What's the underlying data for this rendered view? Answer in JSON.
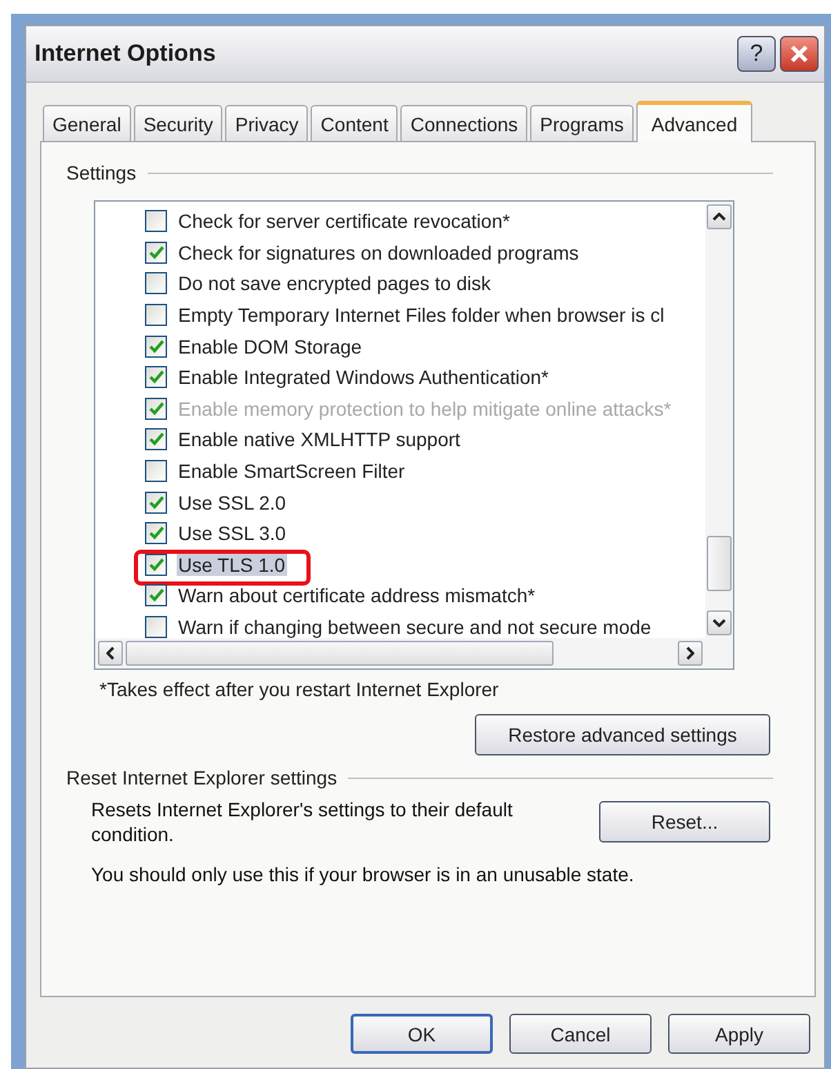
{
  "window": {
    "title": "Internet Options",
    "title_buttons": [
      "?"
    ]
  },
  "tabs": [
    {
      "label": "General",
      "selected": false
    },
    {
      "label": "Security",
      "selected": false
    },
    {
      "label": "Privacy",
      "selected": false
    },
    {
      "label": "Content",
      "selected": false
    },
    {
      "label": "Connections",
      "selected": false
    },
    {
      "label": "Programs",
      "selected": false
    },
    {
      "label": "Advanced",
      "selected": true
    }
  ],
  "settings": {
    "heading": "Settings",
    "items": [
      {
        "label": "Check for server certificate revocation*",
        "checked": false,
        "disabled": false,
        "selected": false,
        "outlined": false
      },
      {
        "label": "Check for signatures on downloaded programs",
        "checked": true,
        "disabled": false,
        "selected": false,
        "outlined": false
      },
      {
        "label": "Do not save encrypted pages to disk",
        "checked": false,
        "disabled": false,
        "selected": false,
        "outlined": false
      },
      {
        "label": "Empty Temporary Internet Files folder when browser is cl",
        "checked": false,
        "disabled": false,
        "selected": false,
        "outlined": false
      },
      {
        "label": "Enable DOM Storage",
        "checked": true,
        "disabled": false,
        "selected": false,
        "outlined": false
      },
      {
        "label": "Enable Integrated Windows Authentication*",
        "checked": true,
        "disabled": false,
        "selected": false,
        "outlined": false
      },
      {
        "label": "Enable memory protection to help mitigate online attacks*",
        "checked": true,
        "disabled": true,
        "selected": false,
        "outlined": false
      },
      {
        "label": "Enable native XMLHTTP support",
        "checked": true,
        "disabled": false,
        "selected": false,
        "outlined": false
      },
      {
        "label": "Enable SmartScreen Filter",
        "checked": false,
        "disabled": false,
        "selected": false,
        "outlined": false
      },
      {
        "label": "Use SSL 2.0",
        "checked": true,
        "disabled": false,
        "selected": false,
        "outlined": false
      },
      {
        "label": "Use SSL 3.0",
        "checked": true,
        "disabled": false,
        "selected": false,
        "outlined": false
      },
      {
        "label": "Use TLS 1.0",
        "checked": true,
        "disabled": false,
        "selected": true,
        "outlined": true
      },
      {
        "label": "Warn about certificate address mismatch*",
        "checked": true,
        "disabled": false,
        "selected": false,
        "outlined": false
      },
      {
        "label": "Warn if changing between secure and not secure mode",
        "checked": false,
        "disabled": false,
        "selected": false,
        "outlined": false
      }
    ],
    "note": "*Takes effect after you restart Internet Explorer",
    "restore_button": "Restore advanced settings"
  },
  "reset": {
    "heading": "Reset Internet Explorer settings",
    "description": "Resets Internet Explorer's settings to their default condition.",
    "button": "Reset...",
    "warning": "You should only use this if your browser is in an unusable state."
  },
  "buttons": [
    "OK",
    "Cancel",
    "Apply"
  ]
}
